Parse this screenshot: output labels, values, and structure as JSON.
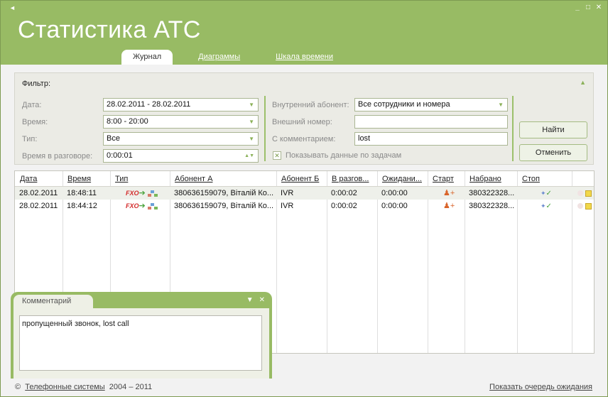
{
  "window": {
    "title": "Статистика АТС",
    "controls": [
      "minimize",
      "maximize",
      "close"
    ]
  },
  "tabs": [
    {
      "label": "Журнал",
      "active": true
    },
    {
      "label": "Диаграммы",
      "active": false
    },
    {
      "label": "Шкала времени",
      "active": false
    }
  ],
  "filter": {
    "heading": "Фильтр:",
    "date_label": "Дата:",
    "date_value": "28.02.2011 - 28.02.2011",
    "time_label": "Время:",
    "time_value": "8:00 - 20:00",
    "type_label": "Тип:",
    "type_value": "Все",
    "talk_time_label": "Время в разговоре:",
    "talk_time_value": "0:00:01",
    "internal_label": "Внутренний абонент:",
    "internal_value": "Все сотрудники и номера",
    "external_label": "Внешний номер:",
    "external_value": "",
    "comment_label": "С комментарием:",
    "comment_value": "lost",
    "show_tasks_label": "Показывать данные  по задачам",
    "show_tasks_checked": true,
    "find_button": "Найти",
    "cancel_button": "Отменить"
  },
  "table": {
    "columns": [
      "Дата",
      "Время",
      "Тип",
      "Абонент А",
      "Абонент Б",
      "В разгов...",
      "Ожидани...",
      "Старт",
      "Набрано",
      "Стоп"
    ],
    "rows": [
      {
        "date": "28.02.2011",
        "time": "18:48:11",
        "type": "FXO",
        "a": "380636159079, Віталій Ко...",
        "b": "IVR",
        "talk": "0:00:02",
        "wait": "0:00:00",
        "dialed": "380322328...",
        "selected": true
      },
      {
        "date": "28.02.2011",
        "time": "18:44:12",
        "type": "FXO",
        "a": "380636159079, Віталій Ко...",
        "b": "IVR",
        "talk": "0:00:02",
        "wait": "0:00:00",
        "dialed": "380322328...",
        "selected": false
      }
    ]
  },
  "comment_panel": {
    "tab_label": "Комментарий",
    "text": "пропущенный звонок, lost call"
  },
  "footer": {
    "copyright": "©",
    "company": "Телефонные системы",
    "years": "2004 – 2011",
    "queue_link": "Показать очередь ожидания"
  },
  "colors": {
    "brand_green": "#98bb64",
    "accent_green": "#8bb159"
  }
}
